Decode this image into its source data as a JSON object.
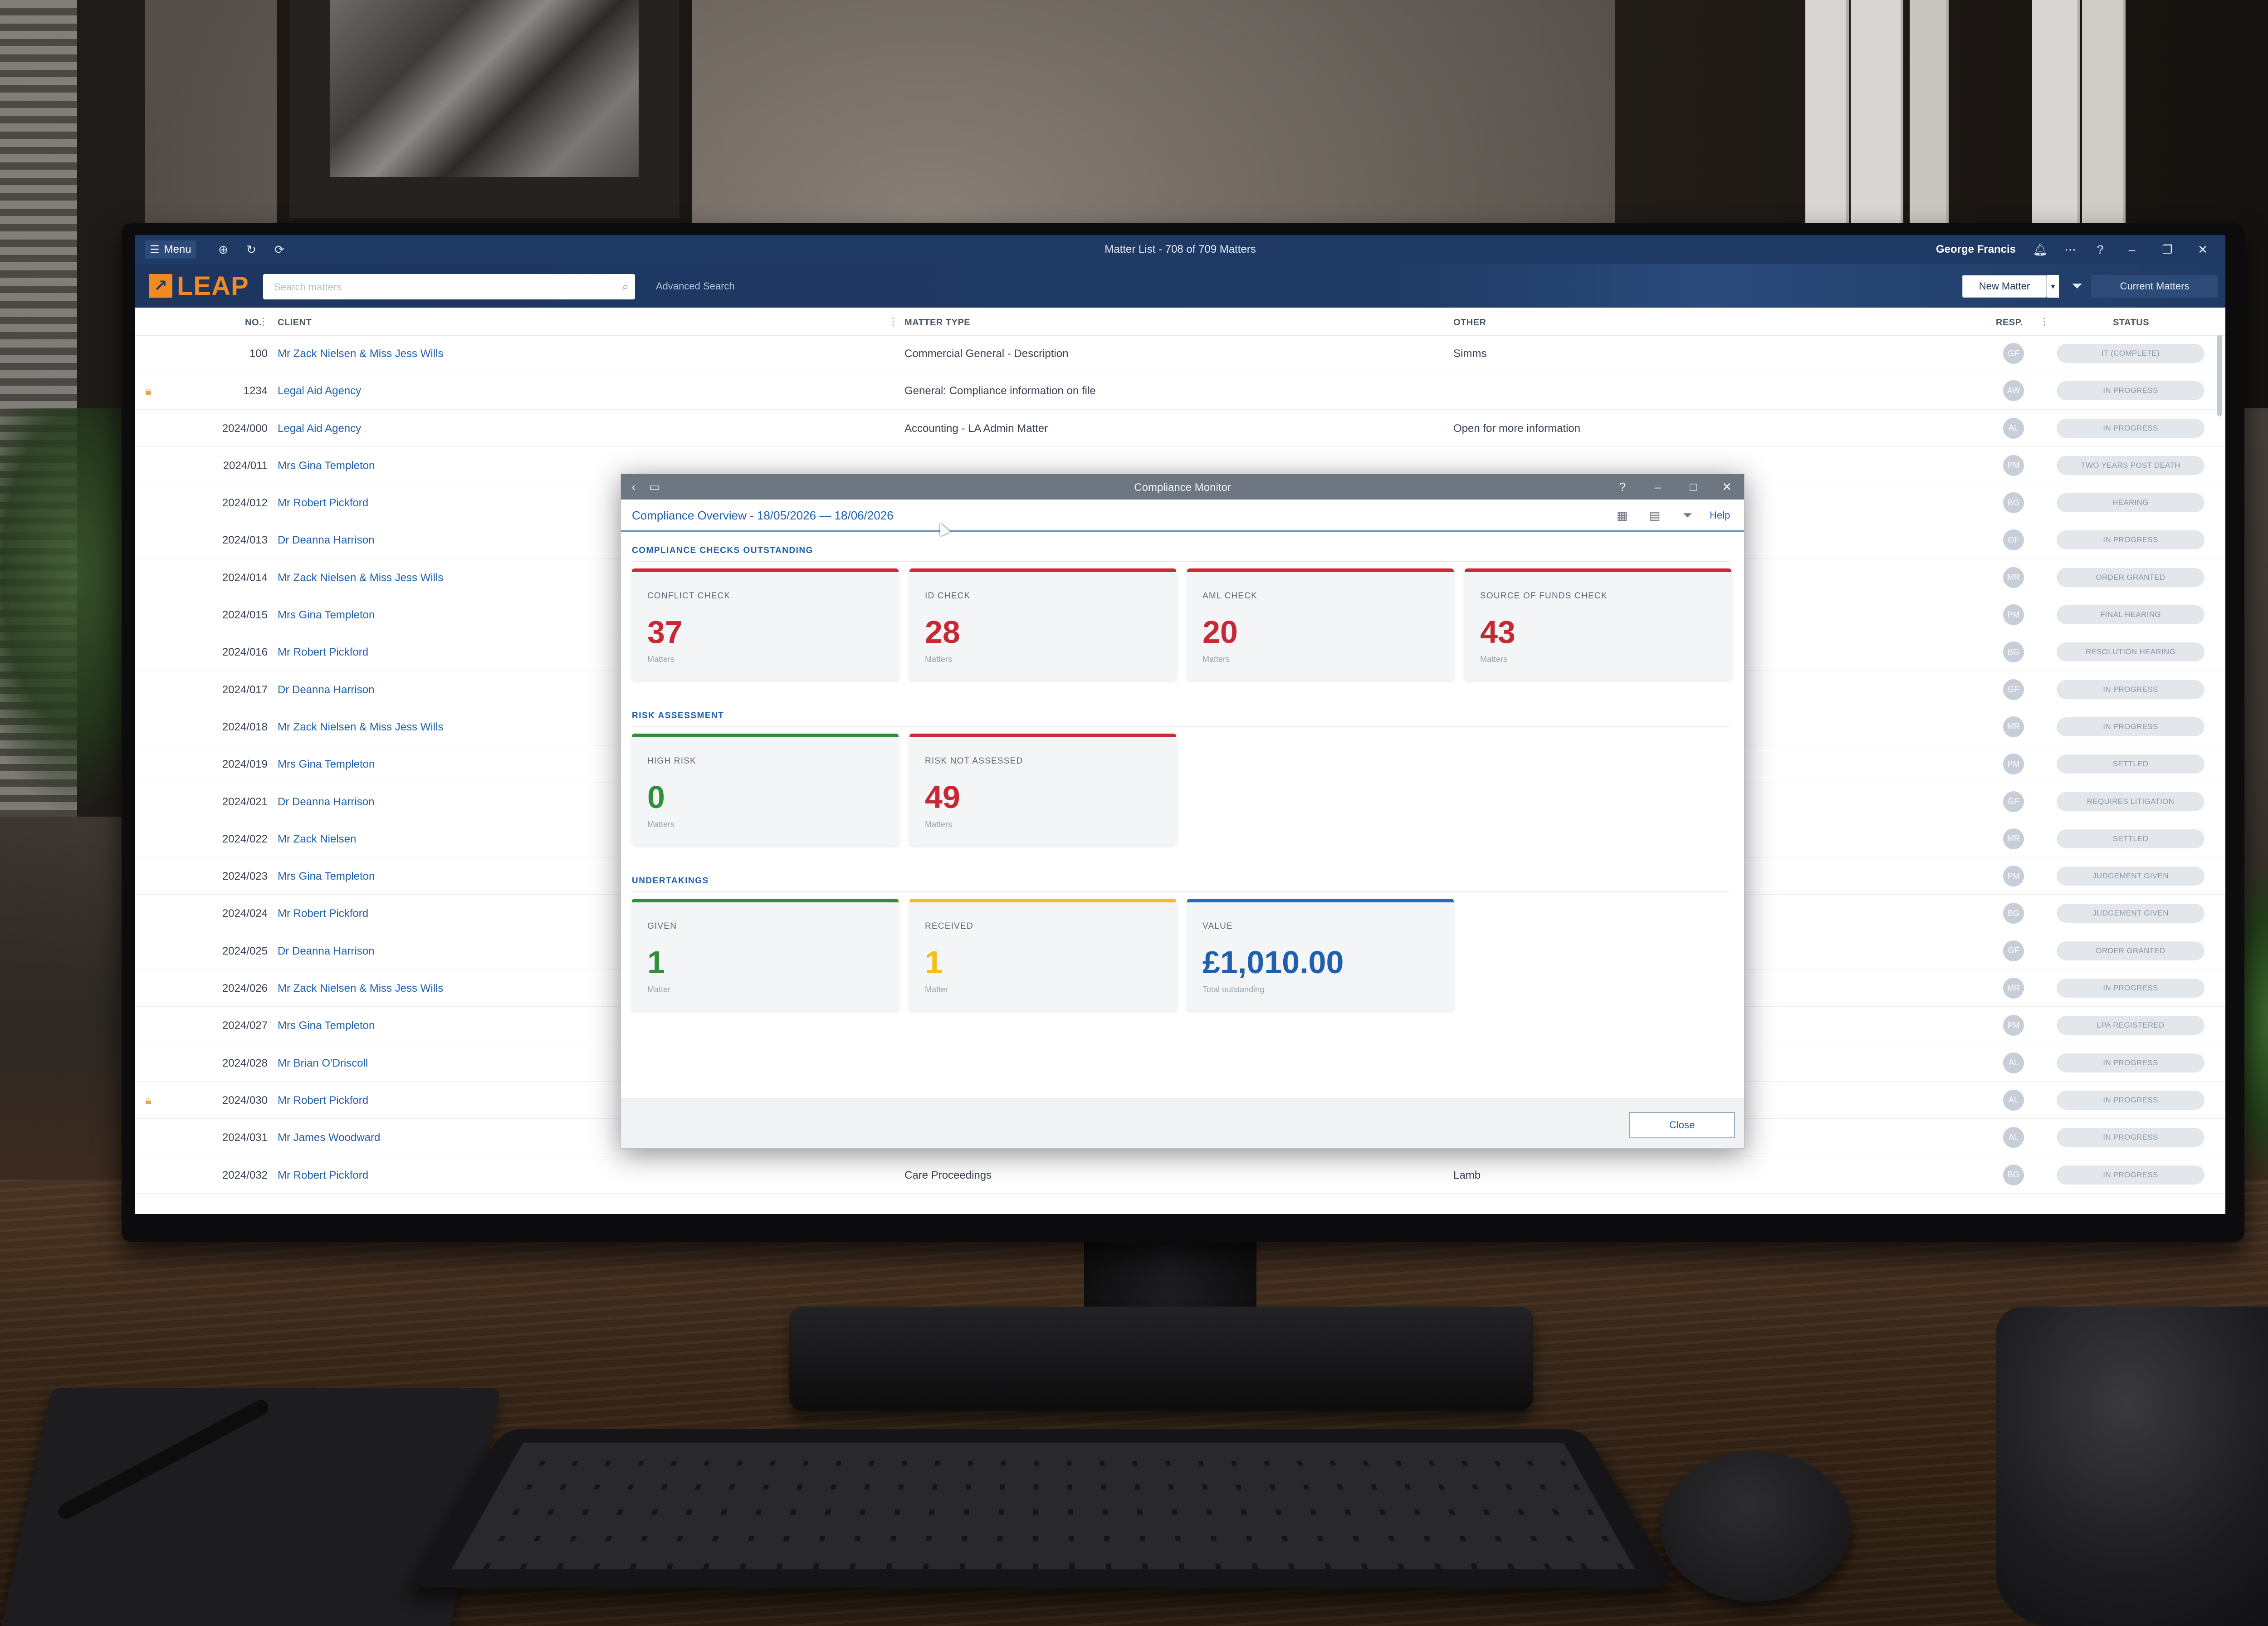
{
  "titlebar": {
    "menu_label": "Menu",
    "window_title": "Matter List - 708 of 709 Matters",
    "user_name": "George Francis"
  },
  "brandbar": {
    "logo_text": "LEAP",
    "search_placeholder": "Search matters",
    "advanced_search": "Advanced Search",
    "new_matter": "New Matter",
    "current_matters": "Current Matters"
  },
  "columns": {
    "no": "NO.",
    "client": "CLIENT",
    "matter_type": "MATTER TYPE",
    "other": "OTHER",
    "resp": "RESP.",
    "status": "STATUS"
  },
  "matters": [
    {
      "no": "100",
      "client": "Mr Zack Nielsen & Miss Jess Wills",
      "type": "Commercial General - Description",
      "other": "Simms",
      "resp": "GF",
      "status": "IT (COMPLETE)",
      "locked": false
    },
    {
      "no": "1234",
      "client": "Legal Aid Agency",
      "type": "General: Compliance information on file",
      "other": "",
      "resp": "AW",
      "status": "IN PROGRESS",
      "locked": true
    },
    {
      "no": "2024/000",
      "client": "Legal Aid Agency",
      "type": "Accounting - LA Admin Matter",
      "other": "Open for more information",
      "resp": "AL",
      "status": "IN PROGRESS",
      "locked": false
    },
    {
      "no": "2024/011",
      "client": "Mrs Gina Templeton",
      "type": "",
      "other": "",
      "resp": "PM",
      "status": "TWO YEARS POST DEATH",
      "locked": false
    },
    {
      "no": "2024/012",
      "client": "Mr Robert Pickford",
      "type": "",
      "other": "",
      "resp": "BG",
      "status": "HEARING",
      "locked": false
    },
    {
      "no": "2024/013",
      "client": "Dr Deanna Harrison",
      "type": "",
      "other": "",
      "resp": "GF",
      "status": "IN PROGRESS",
      "locked": false
    },
    {
      "no": "2024/014",
      "client": "Mr Zack Nielsen & Miss Jess Wills",
      "type": "",
      "other": "",
      "resp": "MR",
      "status": "ORDER GRANTED",
      "locked": false
    },
    {
      "no": "2024/015",
      "client": "Mrs Gina Templeton",
      "type": "",
      "other": "",
      "resp": "PM",
      "status": "FINAL HEARING",
      "locked": false
    },
    {
      "no": "2024/016",
      "client": "Mr Robert Pickford",
      "type": "",
      "other": "",
      "resp": "BG",
      "status": "RESOLUTION HEARING",
      "locked": false
    },
    {
      "no": "2024/017",
      "client": "Dr Deanna Harrison",
      "type": "",
      "other": "",
      "resp": "GF",
      "status": "IN PROGRESS",
      "locked": false
    },
    {
      "no": "2024/018",
      "client": "Mr Zack Nielsen & Miss Jess Wills",
      "type": "",
      "other": "",
      "resp": "MR",
      "status": "IN PROGRESS",
      "locked": false
    },
    {
      "no": "2024/019",
      "client": "Mrs Gina Templeton",
      "type": "",
      "other": "",
      "resp": "PM",
      "status": "SETTLED",
      "locked": false
    },
    {
      "no": "2024/021",
      "client": "Dr Deanna Harrison",
      "type": "",
      "other": "",
      "resp": "GF",
      "status": "REQUIRES LITIGATION",
      "locked": false
    },
    {
      "no": "2024/022",
      "client": "Mr Zack Nielsen",
      "type": "",
      "other": "",
      "resp": "MR",
      "status": "SETTLED",
      "locked": false
    },
    {
      "no": "2024/023",
      "client": "Mrs Gina Templeton",
      "type": "",
      "other": "",
      "resp": "PM",
      "status": "JUDGEMENT GIVEN",
      "locked": false
    },
    {
      "no": "2024/024",
      "client": "Mr Robert Pickford",
      "type": "",
      "other": "",
      "resp": "BG",
      "status": "JUDGEMENT GIVEN",
      "locked": false
    },
    {
      "no": "2024/025",
      "client": "Dr Deanna Harrison",
      "type": "",
      "other": "",
      "resp": "GF",
      "status": "ORDER GRANTED",
      "locked": false
    },
    {
      "no": "2024/026",
      "client": "Mr Zack Nielsen & Miss Jess Wills",
      "type": "",
      "other": "",
      "resp": "MR",
      "status": "IN PROGRESS",
      "locked": false
    },
    {
      "no": "2024/027",
      "client": "Mrs Gina Templeton",
      "type": "",
      "other": "",
      "resp": "PM",
      "status": "LPA REGISTERED",
      "locked": false
    },
    {
      "no": "2024/028",
      "client": "Mr Brian O'Driscoll",
      "type": "",
      "other": "",
      "resp": "AL",
      "status": "IN PROGRESS",
      "locked": false
    },
    {
      "no": "2024/030",
      "client": "Mr Robert Pickford",
      "type": "",
      "other": "",
      "resp": "AL",
      "status": "IN PROGRESS",
      "locked": true
    },
    {
      "no": "2024/031",
      "client": "Mr James Woodward",
      "type": "",
      "other": "",
      "resp": "AL",
      "status": "IN PROGRESS",
      "locked": false
    },
    {
      "no": "2024/032",
      "client": "Mr Robert Pickford",
      "type": "Care Proceedings",
      "other": "Lamb",
      "resp": "BG",
      "status": "IN PROGRESS",
      "locked": false
    }
  ],
  "dialog": {
    "window_title": "Compliance Monitor",
    "overview_title": "Compliance Overview  - 18/05/2026 — 18/06/2026",
    "help": "Help",
    "close": "Close",
    "sections": [
      {
        "label": "COMPLIANCE CHECKS OUTSTANDING",
        "cards": [
          {
            "label": "CONFLICT CHECK",
            "value": "37",
            "unit": "Matters",
            "accent": "#cc2a36",
            "value_color": "#c62834"
          },
          {
            "label": "ID CHECK",
            "value": "28",
            "unit": "Matters",
            "accent": "#cc2a36",
            "value_color": "#c62834"
          },
          {
            "label": "AML CHECK",
            "value": "20",
            "unit": "Matters",
            "accent": "#cc2a36",
            "value_color": "#c62834"
          },
          {
            "label": "SOURCE OF FUNDS CHECK",
            "value": "43",
            "unit": "Matters",
            "accent": "#cc2a36",
            "value_color": "#c62834"
          }
        ]
      },
      {
        "label": "RISK ASSESSMENT",
        "cards": [
          {
            "label": "HIGH RISK",
            "value": "0",
            "unit": "Matters",
            "accent": "#2f8f3a",
            "value_color": "#2f8f3a"
          },
          {
            "label": "RISK NOT ASSESSED",
            "value": "49",
            "unit": "Matters",
            "accent": "#cc2a36",
            "value_color": "#c62834"
          }
        ]
      },
      {
        "label": "UNDERTAKINGS",
        "cards": [
          {
            "label": "GIVEN",
            "value": "1",
            "unit": "Matter",
            "accent": "#2f8f3a",
            "value_color": "#2f8f3a"
          },
          {
            "label": "RECEIVED",
            "value": "1",
            "unit": "Matter",
            "accent": "#f2be22",
            "value_color": "#f2be22"
          },
          {
            "label": "VALUE",
            "value": "£1,010.00",
            "unit": "Total outstanding",
            "accent": "#1f6fc0",
            "value_color": "#1f5fae"
          }
        ]
      }
    ]
  },
  "icons": {
    "menu": "hamburger-icon",
    "bell": "bell-icon",
    "help": "question-icon",
    "filter": "filter-icon",
    "lock": "lock-icon",
    "search": "search-icon",
    "close": "close-icon",
    "minimize": "minimize-icon",
    "maximize": "maximize-icon",
    "back": "chevron-left-icon"
  }
}
